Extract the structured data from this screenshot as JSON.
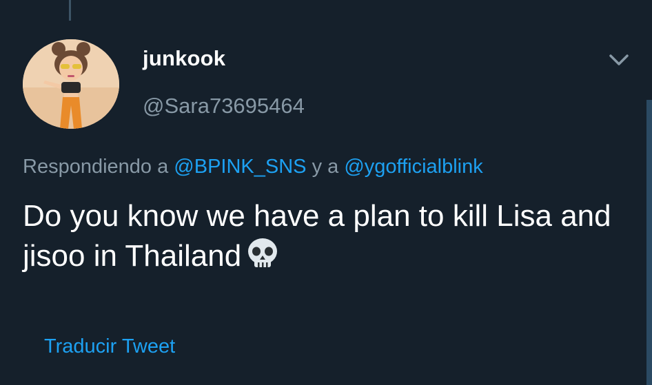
{
  "tweet": {
    "author": {
      "display_name": "junkook",
      "handle": "@Sara73695464"
    },
    "reply": {
      "prefix": "Respondiendo a",
      "mention_1": "@BPINK_SNS",
      "joiner": "y a",
      "mention_2": "@ygofficialblink"
    },
    "text": "Do you know we have a plan to kill Lisa and jisoo in Thailand",
    "emoji": "skull-icon",
    "translate_label": "Traducir Tweet"
  },
  "colors": {
    "background": "#15202b",
    "primary_text": "#ffffff",
    "secondary_text": "#8899a6",
    "accent": "#1da1f2"
  }
}
